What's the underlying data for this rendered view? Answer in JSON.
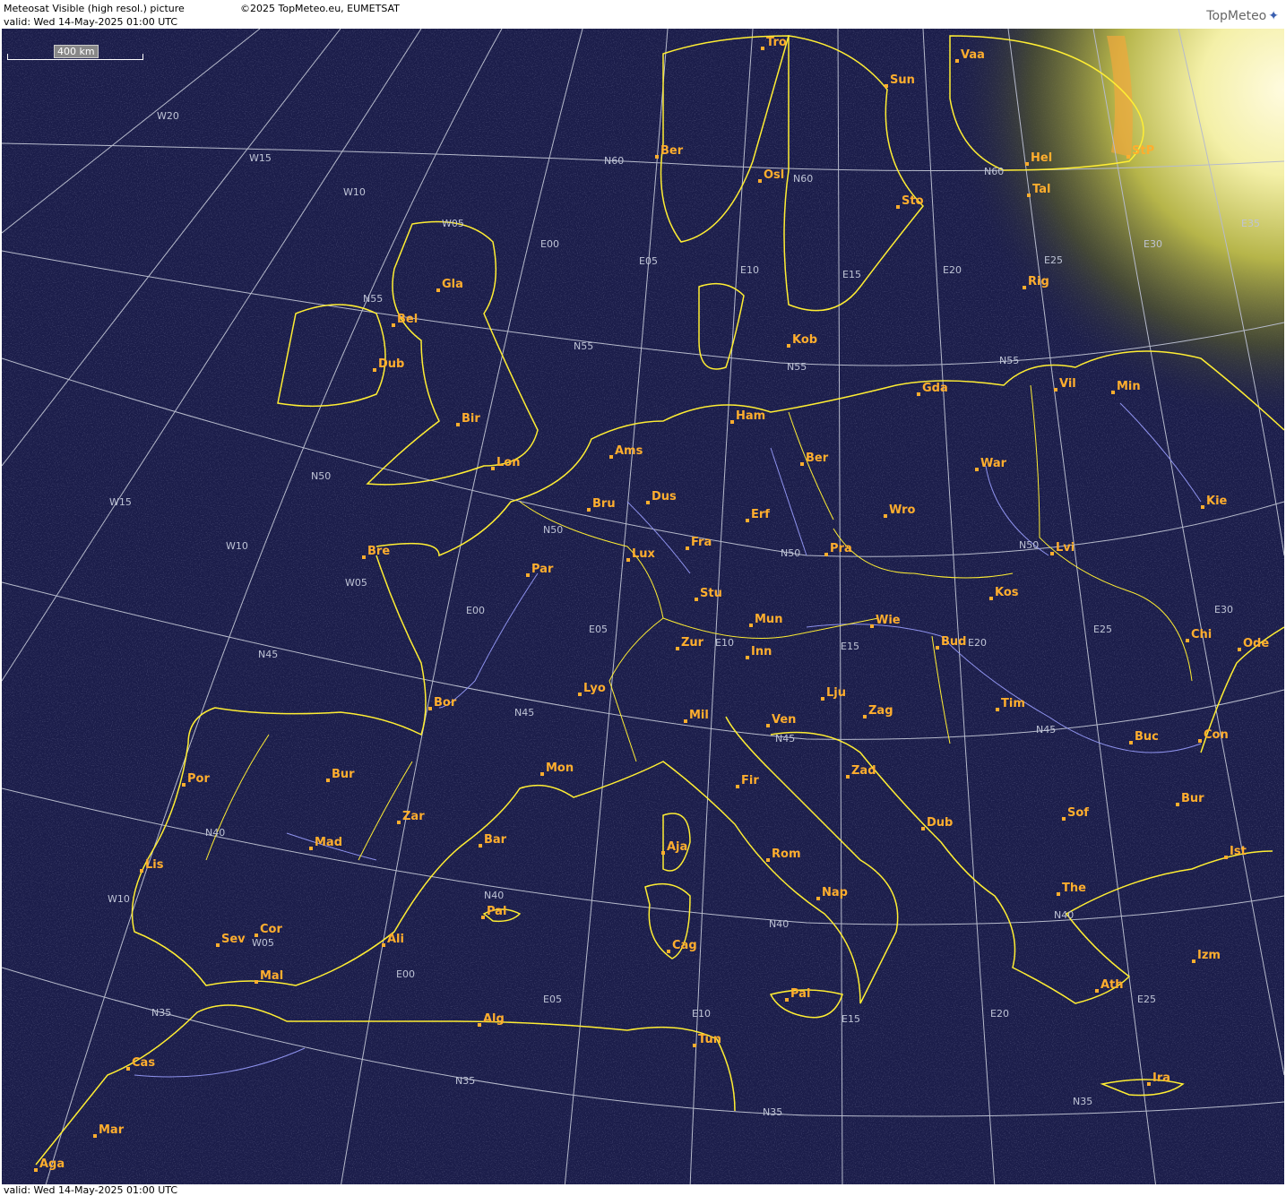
{
  "header": {
    "title": "Meteosat Visible (high resol.) picture",
    "valid": "valid:  Wed  14-May-2025  01:00 UTC",
    "copyright": "©2025 TopMeteo.eu, EUMETSAT",
    "logo": "TopMeteo"
  },
  "footer": {
    "valid": "valid:  Wed  14-May-2025  01:00 UTC"
  },
  "scale_label": "400 km",
  "colors": {
    "background": "#1b1d4a",
    "coast": "#ffee33",
    "rivers": "#8f93ee",
    "grid": "#b7bbcc",
    "cities": "#ffae2e",
    "dawn": "#fff6b0"
  },
  "grid_labels": [
    "W20",
    "W15",
    "W10",
    "W05",
    "E00",
    "E05",
    "E10",
    "E15",
    "E20",
    "E25",
    "E30",
    "E35",
    "N60",
    "N55",
    "N50",
    "N45",
    "N40",
    "N35"
  ],
  "cities": [
    {
      "name": "Tro"
    },
    {
      "name": "Vaa"
    },
    {
      "name": "Sun"
    },
    {
      "name": "Ber"
    },
    {
      "name": "Osl"
    },
    {
      "name": "Sto"
    },
    {
      "name": "Hel"
    },
    {
      "name": "StP"
    },
    {
      "name": "Tal"
    },
    {
      "name": "Rig"
    },
    {
      "name": "Gla"
    },
    {
      "name": "Bel"
    },
    {
      "name": "Dub"
    },
    {
      "name": "Kob"
    },
    {
      "name": "Vil"
    },
    {
      "name": "Min"
    },
    {
      "name": "Gda"
    },
    {
      "name": "Bir"
    },
    {
      "name": "Ham"
    },
    {
      "name": "Ams"
    },
    {
      "name": "Lon"
    },
    {
      "name": "Ber"
    },
    {
      "name": "War"
    },
    {
      "name": "Bru"
    },
    {
      "name": "Dus"
    },
    {
      "name": "Erf"
    },
    {
      "name": "Kie"
    },
    {
      "name": "Wro"
    },
    {
      "name": "Bre"
    },
    {
      "name": "Fra"
    },
    {
      "name": "Lux"
    },
    {
      "name": "Par"
    },
    {
      "name": "Pra"
    },
    {
      "name": "Lvi"
    },
    {
      "name": "Stu"
    },
    {
      "name": "Kos"
    },
    {
      "name": "Mun"
    },
    {
      "name": "Wie"
    },
    {
      "name": "Zur"
    },
    {
      "name": "Inn"
    },
    {
      "name": "Bud"
    },
    {
      "name": "Chi"
    },
    {
      "name": "Ode"
    },
    {
      "name": "Lyo"
    },
    {
      "name": "Lju"
    },
    {
      "name": "Tim"
    },
    {
      "name": "Bor"
    },
    {
      "name": "Mil"
    },
    {
      "name": "Zag"
    },
    {
      "name": "Ven"
    },
    {
      "name": "Buc"
    },
    {
      "name": "Con"
    },
    {
      "name": "Mon"
    },
    {
      "name": "Por"
    },
    {
      "name": "Bur"
    },
    {
      "name": "Fir"
    },
    {
      "name": "Zad"
    },
    {
      "name": "Zar"
    },
    {
      "name": "Bur"
    },
    {
      "name": "Dub"
    },
    {
      "name": "Sof"
    },
    {
      "name": "Mad"
    },
    {
      "name": "Bar"
    },
    {
      "name": "Aja"
    },
    {
      "name": "Rom"
    },
    {
      "name": "Ist"
    },
    {
      "name": "Lis"
    },
    {
      "name": "The"
    },
    {
      "name": "Nap"
    },
    {
      "name": "Pal"
    },
    {
      "name": "Cor"
    },
    {
      "name": "Sev"
    },
    {
      "name": "Ali"
    },
    {
      "name": "Cag"
    },
    {
      "name": "Izm"
    },
    {
      "name": "Mal"
    },
    {
      "name": "Pal"
    },
    {
      "name": "Ath"
    },
    {
      "name": "Alg"
    },
    {
      "name": "Tun"
    },
    {
      "name": "Cas"
    },
    {
      "name": "Ira"
    },
    {
      "name": "Mar"
    },
    {
      "name": "Aga"
    }
  ]
}
